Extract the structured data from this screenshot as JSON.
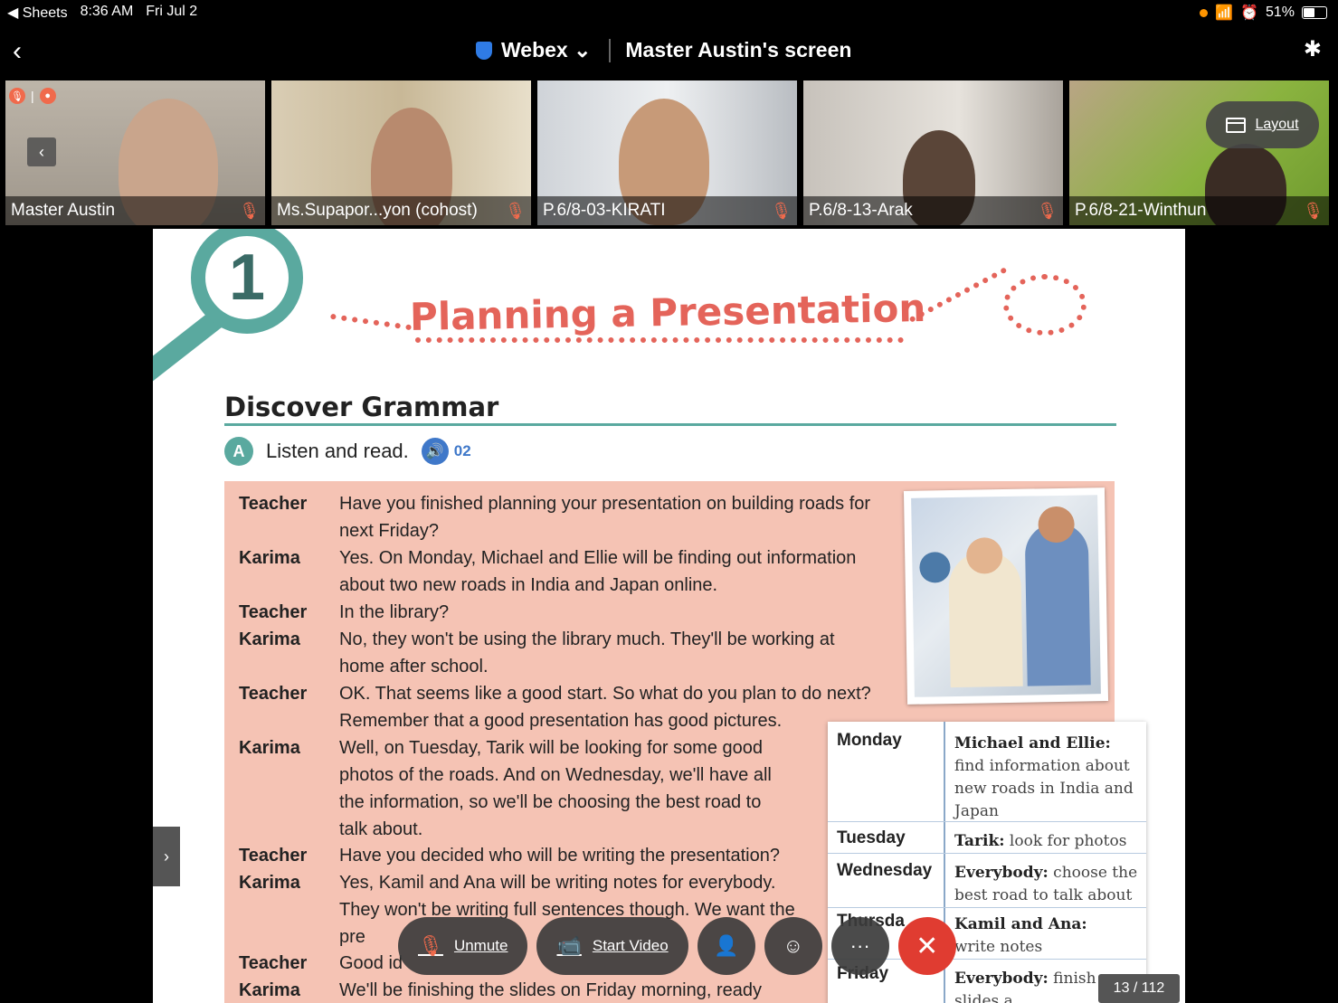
{
  "status_bar": {
    "back_app": "◀ Sheets",
    "time": "8:36 AM",
    "date": "Fri Jul 2",
    "battery": "51%"
  },
  "header": {
    "app_name": "Webex",
    "screen_title": "Master Austin's screen"
  },
  "participants": [
    {
      "name": "Master Austin"
    },
    {
      "name": "Ms.Supapor...yon (cohost)"
    },
    {
      "name": "P.6/8-03-KIRATI"
    },
    {
      "name": "P.6/8-13-Arak"
    },
    {
      "name": "P.6/8-21-Winthun"
    }
  ],
  "layout_button": {
    "label": "Layout"
  },
  "document": {
    "unit_number": "1",
    "title": "Planning a Presentation",
    "section": "Discover Grammar",
    "exercise_letter": "A",
    "instruction": "Listen and read.",
    "track": "02",
    "dialog": [
      {
        "speaker": "Teacher",
        "text": "Have you finished planning your presentation on building roads for next Friday?"
      },
      {
        "speaker": "Karima",
        "text": "Yes. On Monday, Michael and Ellie will be finding out information about two new roads in India and Japan online."
      },
      {
        "speaker": "Teacher",
        "text": "In the library?"
      },
      {
        "speaker": "Karima",
        "text": "No, they won't be using the library much. They'll be working at home after school."
      },
      {
        "speaker": "Teacher",
        "text": "OK. That seems like a good start. So what do you plan to do next? Remember that a good presentation has good pictures."
      },
      {
        "speaker": "Karima",
        "text": "Well, on Tuesday, Tarik will be looking for some good photos of the roads. And on Wednesday, we'll have all the information, so we'll be choosing the best road to talk about."
      },
      {
        "speaker": "Teacher",
        "text": "Have you decided who will be writing the presentation?"
      },
      {
        "speaker": "Karima",
        "text": "Yes, Kamil and Ana will be writing notes for everybody. They won't be writing full sentences though. We want the pre"
      },
      {
        "speaker": "Teacher",
        "text": "Good id"
      },
      {
        "speaker": "Karima",
        "text": "We'll be finishing the slides on Friday morning, ready"
      }
    ],
    "notebook": {
      "days": [
        "Monday",
        "Tuesday",
        "Wednesday",
        "Thursda",
        "Friday"
      ],
      "notes": [
        {
          "who": "Michael and Ellie:",
          "what": "find information about new roads in India and Japan"
        },
        {
          "who": "Tarik:",
          "what": "look for photos"
        },
        {
          "who": "Everybody:",
          "what": "choose the best road to talk about"
        },
        {
          "who": "Kamil and Ana:",
          "what": "write notes"
        },
        {
          "who": "Everybody:",
          "what": "finish slides a..."
        }
      ]
    },
    "page_indicator": "13 / 112"
  },
  "toolbar": {
    "unmute": "Unmute",
    "start_video": "Start Video",
    "more": "···",
    "end": "✕"
  }
}
